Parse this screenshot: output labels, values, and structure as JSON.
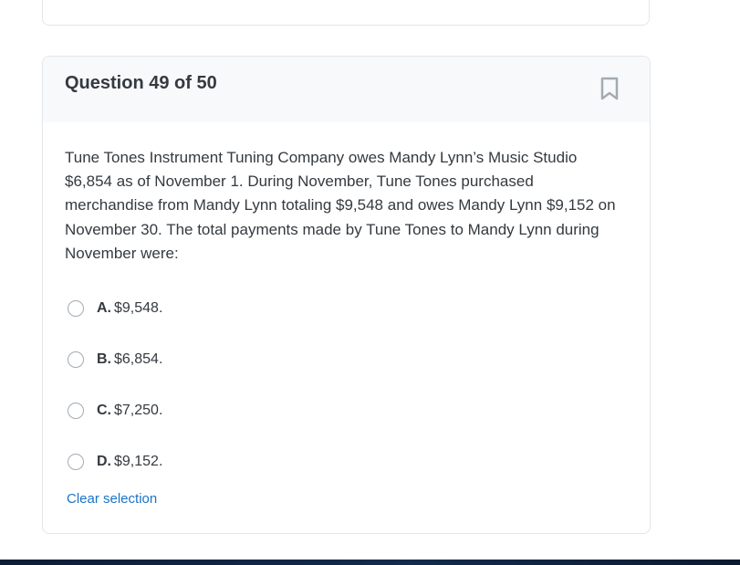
{
  "question": {
    "title": "Question 49 of 50",
    "text": "Tune Tones Instrument Tuning Company owes Mandy Lynn’s Music Studio $6,854 as of November 1. During November, Tune Tones purchased merchandise from Mandy Lynn totaling $9,548 and owes Mandy Lynn $9,152 on November 30. The total payments made by Tune Tones to Mandy Lynn during November were:",
    "options": [
      {
        "letter": "A.",
        "text": "$9,548."
      },
      {
        "letter": "B.",
        "text": "$6,854."
      },
      {
        "letter": "C.",
        "text": "$7,250."
      },
      {
        "letter": "D.",
        "text": "$9,152."
      }
    ],
    "clear_label": "Clear selection",
    "bookmark_icon": "bookmark-icon"
  },
  "colors": {
    "accent_link": "#1a73c9",
    "header_bg": "#f8f9fa",
    "border": "#e3e6ea",
    "icon_gray": "#a3abb3"
  }
}
